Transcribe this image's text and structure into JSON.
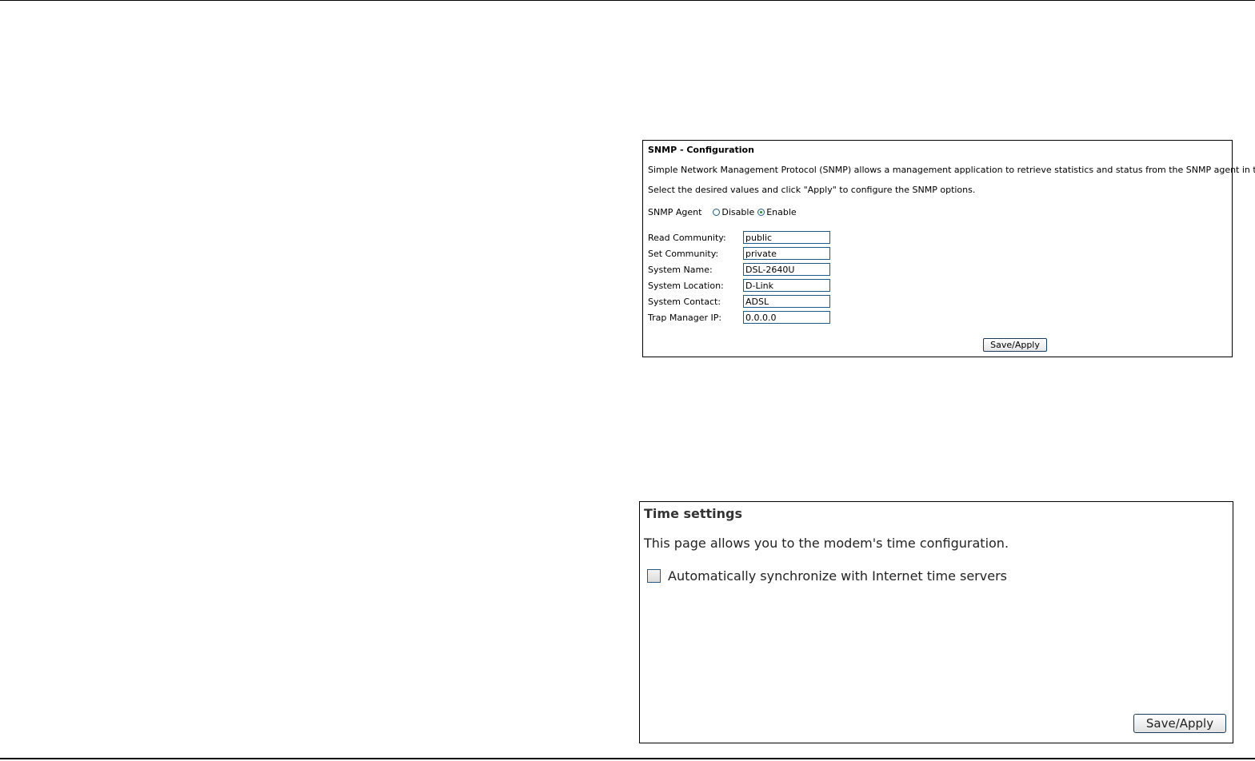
{
  "snmp": {
    "title": "SNMP - Configuration",
    "description": "Simple Network Management Protocol (SNMP) allows a management application to retrieve statistics and status from the SNMP agent in this device.",
    "instruction": "Select the desired values and click \"Apply\" to configure the SNMP options.",
    "agent": {
      "label": "SNMP Agent",
      "options": [
        "Disable",
        "Enable"
      ],
      "selected": "Enable"
    },
    "fields": [
      {
        "label": "Read Community:",
        "value": "public"
      },
      {
        "label": "Set Community:",
        "value": "private"
      },
      {
        "label": "System Name:",
        "value": "DSL-2640U"
      },
      {
        "label": "System Location:",
        "value": "D-Link"
      },
      {
        "label": "System Contact:",
        "value": "ADSL"
      },
      {
        "label": "Trap Manager IP:",
        "value": "0.0.0.0"
      }
    ],
    "save_label": "Save/Apply"
  },
  "time": {
    "title": "Time settings",
    "description": "This page allows you to the modem's time configuration.",
    "sync_label": "Automatically synchronize with Internet time servers",
    "sync_checked": false,
    "save_label": "Save/Apply"
  },
  "colors": {
    "border": "#000000",
    "input_border": "#1a5a8a",
    "radio_selected": "#2e8b3a"
  }
}
